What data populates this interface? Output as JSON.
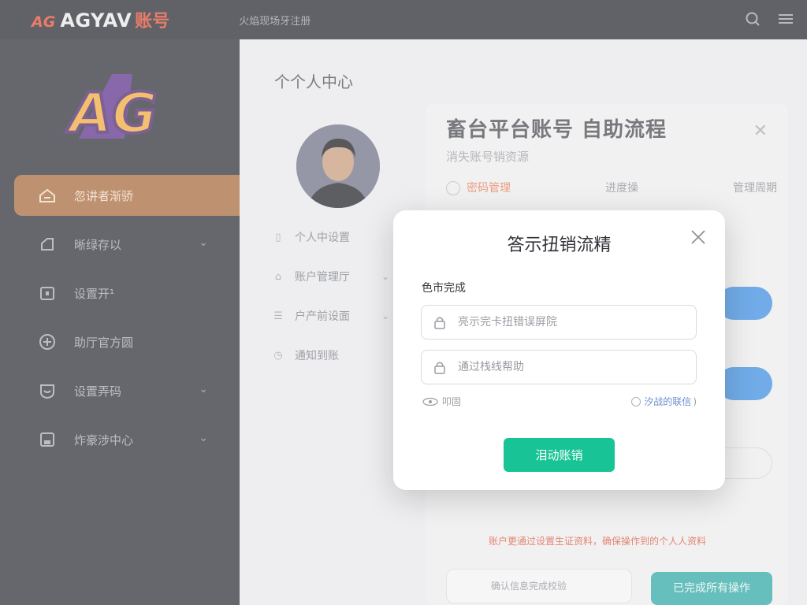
{
  "topbar": {
    "brand_prefix": "AG",
    "brand_main": "AGYAV",
    "brand_sub": "账号",
    "tagline": "火焰现场牙注册"
  },
  "sidebar": {
    "logo_text": "AG",
    "items": [
      {
        "label": "忽讲者渐骄",
        "icon": "home-icon",
        "active": true
      },
      {
        "label": "晰绿存以",
        "icon": "edit-icon",
        "chevron": true
      },
      {
        "label": "设置开¹",
        "icon": "settings-icon"
      },
      {
        "label": "助厅官方圆",
        "icon": "plus-circle-icon"
      },
      {
        "label": "设置弄码",
        "icon": "shield-icon",
        "chevron": true
      },
      {
        "label": "炸豪涉中心",
        "icon": "save-icon",
        "chevron": true
      }
    ]
  },
  "main": {
    "page_title": "个个人中心",
    "sub_menu": [
      {
        "label": "个人中设置",
        "icon": "doc-icon"
      },
      {
        "label": "账户管理厅",
        "icon": "account-icon",
        "chevron": true
      },
      {
        "label": "户产前设面",
        "icon": "gift-icon",
        "chevron": true
      },
      {
        "label": "通知到账",
        "icon": "clock-icon"
      }
    ],
    "panel": {
      "title": "畜台平台账号 自助流程",
      "desc": "消失账号销资源",
      "steps": [
        "密码管理",
        "进度操",
        "管理周期"
      ],
      "warn_text": "账户更通过设置生证资料，确保操作到的个人人资料",
      "bottom_card_text": "确认信息完成校验",
      "teal_button": "已完成所有操作"
    }
  },
  "modal": {
    "title": "答示扭销流精",
    "label": "色市完成",
    "field1_placeholder": "亮示完卡扭错误屏院",
    "field2_placeholder": "通过栈线帮助",
    "hint_left": "叩固",
    "hint_right": "汐战的联信",
    "primary_button": "泪动账销"
  }
}
